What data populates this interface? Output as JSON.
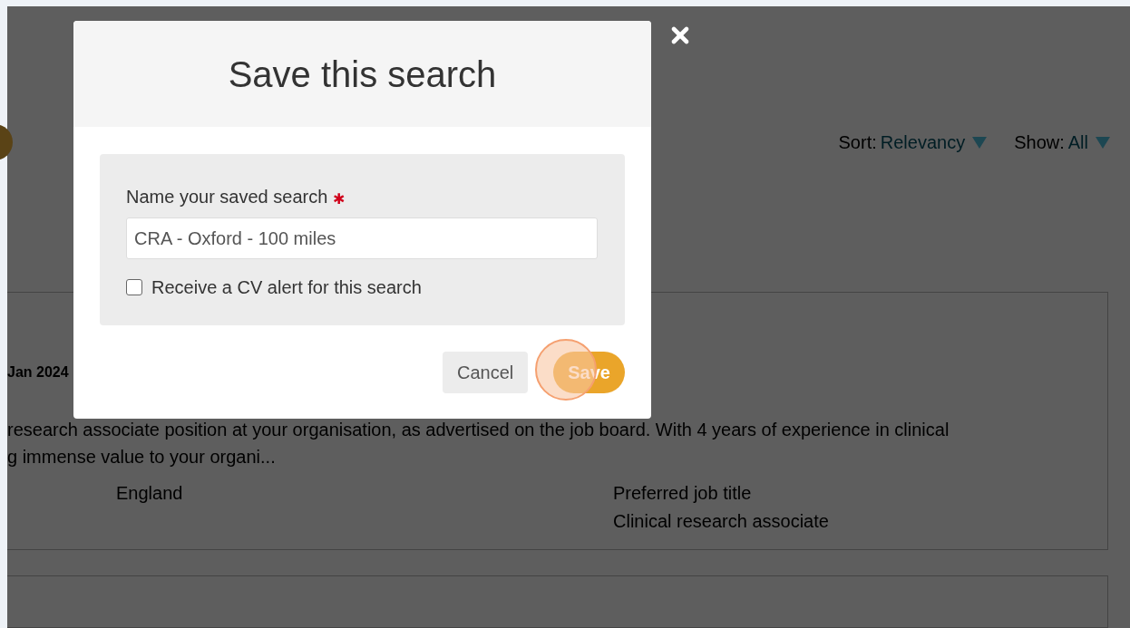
{
  "page": {
    "sort": {
      "label": "Sort:",
      "value": "Relevancy"
    },
    "show": {
      "label": "Show:",
      "value": "All"
    },
    "result": {
      "date": "Jan 2024",
      "summary_lines": [
        "research associate position at your organisation, as advertised on the job board. With 4 years of experience in clinical",
        "g immense value to your organi..."
      ],
      "fields": [
        {
          "value": "England"
        },
        {
          "label": "Preferred job title",
          "value": "Clinical research associate"
        }
      ]
    }
  },
  "dialog": {
    "title": "Save this search",
    "field": {
      "label": "Name your saved search",
      "required_mark": "✱",
      "value": "CRA - Oxford - 100 miles"
    },
    "checkbox": {
      "label": "Receive a CV alert for this search",
      "checked": false
    },
    "buttons": [
      {
        "label": "Cancel",
        "kind": "secondary",
        "highlighted": false
      },
      {
        "label": "Save",
        "kind": "primary",
        "highlighted": true
      }
    ]
  }
}
